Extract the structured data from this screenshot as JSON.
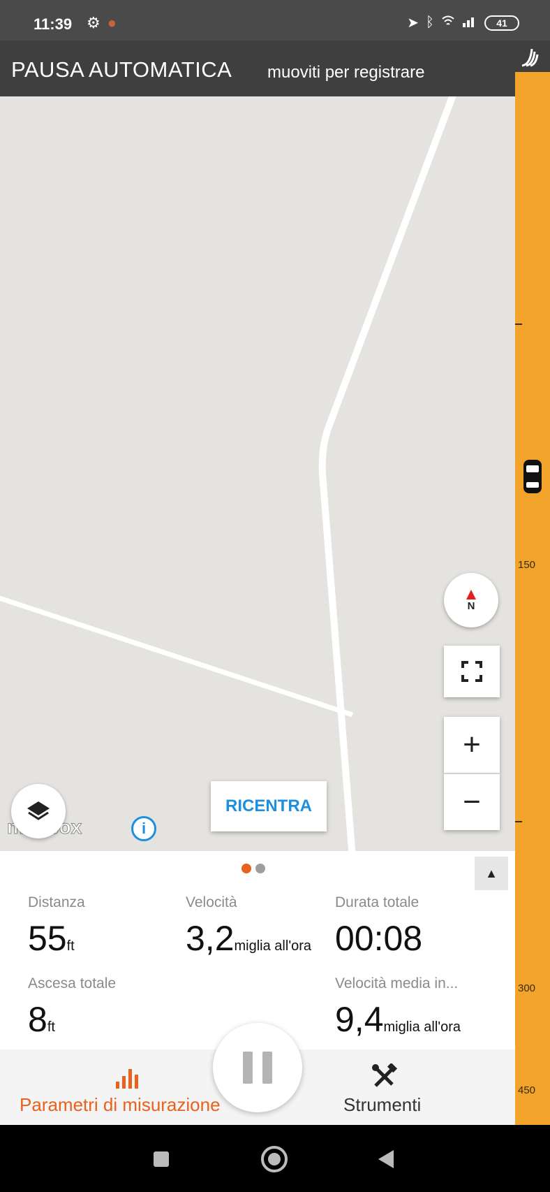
{
  "status_bar": {
    "time": "11:39",
    "left_icons": [
      "sync-off-icon",
      "app-notification-icon"
    ],
    "right_icons": [
      "location-icon",
      "bluetooth-icon",
      "wifi-signal-icon",
      "cell-signal-icon"
    ],
    "battery": "41"
  },
  "banner": {
    "title": "PAUSA AUTOMATICA",
    "subtitle": "muoviti per registrare"
  },
  "map": {
    "attribution": "mapbox",
    "recenter_label": "RICENTRA",
    "compass_label": "N",
    "zoom_in_label": "+",
    "zoom_out_label": "−",
    "info_label": "i"
  },
  "elevation_strip": {
    "labels": [
      "150",
      "300",
      "450"
    ],
    "color": "#f2a32a"
  },
  "stats": {
    "page_indicator": {
      "current": 1,
      "total": 2
    },
    "collapse_label": "▲",
    "distance": {
      "label": "Distanza",
      "value": "55",
      "unit": "ft"
    },
    "speed": {
      "label": "Velocità",
      "value": "3,2",
      "unit": "miglia all'ora"
    },
    "total_duration": {
      "label": "Durata totale",
      "value": "00:08"
    },
    "total_ascent": {
      "label": "Ascesa totale",
      "value": "8",
      "unit": "ft"
    },
    "avg_speed": {
      "label": "Velocità media in...",
      "value": "9,4",
      "unit": "miglia all'ora"
    }
  },
  "bottom_nav": {
    "metrics_label": "Parametri di misurazione",
    "tools_label": "Strumenti",
    "active_color": "#e8621d"
  }
}
